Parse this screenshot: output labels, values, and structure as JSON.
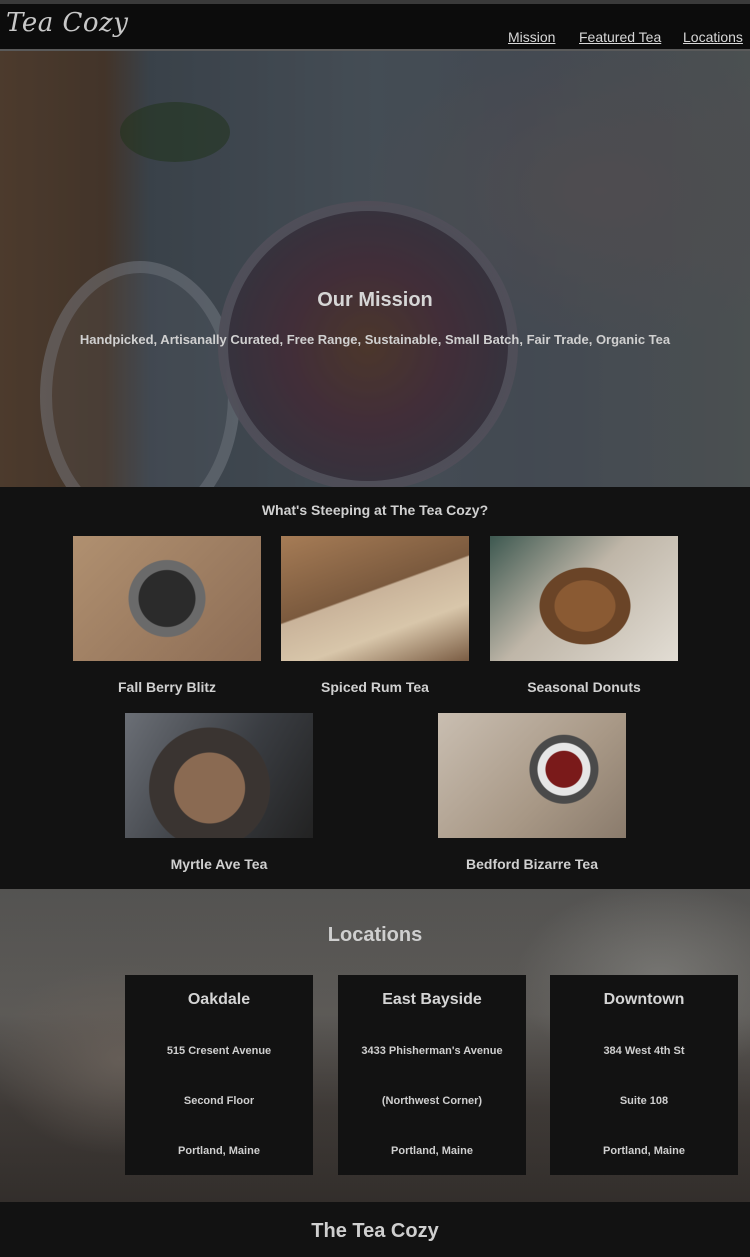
{
  "header": {
    "logo": "Tea Cozy",
    "nav": [
      "Mission",
      "Featured Tea",
      "Locations"
    ]
  },
  "hero": {
    "title": "Our Mission",
    "tagline": "Handpicked, Artisanally Curated, Free Range, Sustainable, Small Batch, Fair Trade, Organic Tea"
  },
  "featured": {
    "heading": "What's Steeping at The Tea Cozy?",
    "items": [
      {
        "name": "Fall Berry Blitz"
      },
      {
        "name": "Spiced Rum Tea"
      },
      {
        "name": "Seasonal Donuts"
      },
      {
        "name": "Myrtle Ave Tea"
      },
      {
        "name": "Bedford Bizarre Tea"
      }
    ]
  },
  "locations": {
    "heading": "Locations",
    "items": [
      {
        "name": "Oakdale",
        "line1": "515 Cresent Avenue",
        "line2": "Second Floor",
        "line3": "Portland, Maine"
      },
      {
        "name": "East Bayside",
        "line1": "3433 Phisherman's Avenue",
        "line2": "(Northwest Corner)",
        "line3": "Portland, Maine"
      },
      {
        "name": "Downtown",
        "line1": "384 West 4th St",
        "line2": "Suite 108",
        "line3": "Portland, Maine"
      }
    ]
  },
  "footer": {
    "text": "The Tea Cozy"
  }
}
